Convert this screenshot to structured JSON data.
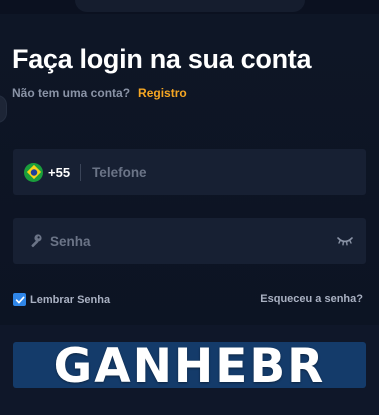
{
  "header": {
    "title": "Faça login na sua conta",
    "no_account": "Não tem uma conta?",
    "register_link": "Registro"
  },
  "phone_field": {
    "country": "Brazil",
    "flag_icon": "brazil-flag-icon",
    "dial_code": "+55",
    "placeholder": "Telefone",
    "value": ""
  },
  "password_field": {
    "icon": "key-icon",
    "placeholder": "Senha",
    "value": "",
    "toggle_icon": "eye-closed-icon"
  },
  "options": {
    "remember_label": "Lembrar Senha",
    "remember_checked": true,
    "forgot_link": "Esqueceu a senha?"
  },
  "watermark": {
    "text": "GANHEBR"
  },
  "colors": {
    "background": "#0d1423",
    "field": "#172033",
    "accent": "#f5a623",
    "checkbox": "#2f86e8",
    "button": "#143b6a"
  }
}
